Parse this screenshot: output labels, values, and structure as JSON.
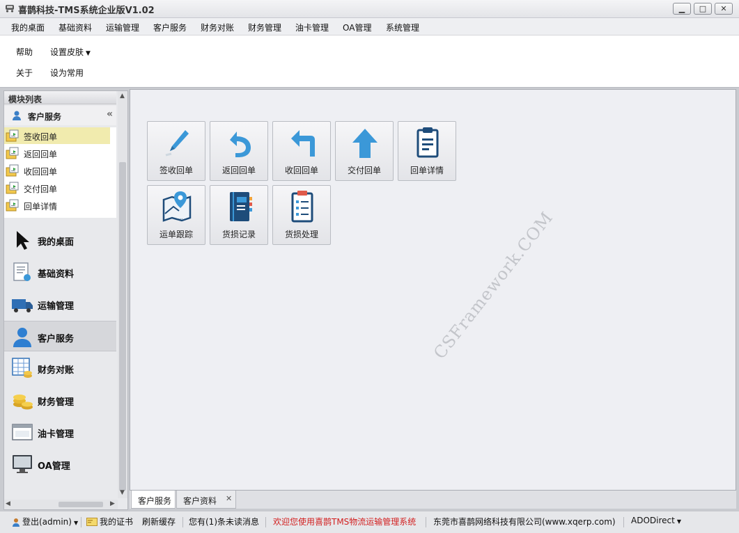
{
  "window": {
    "title": "喜鹊科技-TMS系统企业版V1.02",
    "buttons": [
      "▁",
      "□",
      "✕"
    ]
  },
  "menubar": {
    "items": [
      "我的桌面",
      "基础资料",
      "运输管理",
      "客户服务",
      "财务对账",
      "财务管理",
      "油卡管理",
      "OA管理",
      "系统管理"
    ]
  },
  "ribbon": {
    "help": "帮助",
    "skin": "设置皮肤",
    "about": "关于",
    "favorite": "设为常用"
  },
  "left_panel": {
    "header": "模块列表",
    "group": "客户服务",
    "collapse_glyph": "«",
    "sub_items": [
      {
        "label": "签收回单",
        "selected": true
      },
      {
        "label": "返回回单",
        "selected": false
      },
      {
        "label": "收回回单",
        "selected": false
      },
      {
        "label": "交付回单",
        "selected": false
      },
      {
        "label": "回单详情",
        "selected": false
      }
    ],
    "nav": [
      {
        "label": "我的桌面",
        "icon": "cursor-icon"
      },
      {
        "label": "基础资料",
        "icon": "document-icon"
      },
      {
        "label": "运输管理",
        "icon": "truck-icon"
      },
      {
        "label": "客户服务",
        "icon": "user-icon",
        "active": true
      },
      {
        "label": "财务对账",
        "icon": "spreadsheet-icon"
      },
      {
        "label": "财务管理",
        "icon": "coins-icon"
      },
      {
        "label": "油卡管理",
        "icon": "window-icon"
      },
      {
        "label": "OA管理",
        "icon": "monitor-icon"
      }
    ]
  },
  "tiles": [
    {
      "label": "签收回单",
      "icon": "pen-icon"
    },
    {
      "label": "返回回单",
      "icon": "undo-icon"
    },
    {
      "label": "收回回单",
      "icon": "return-arrow-icon"
    },
    {
      "label": "交付回单",
      "icon": "up-arrow-icon"
    },
    {
      "label": "回单详情",
      "icon": "clipboard-icon"
    },
    {
      "label": "运单跟踪",
      "icon": "map-pin-icon"
    },
    {
      "label": "货损记录",
      "icon": "notebook-icon"
    },
    {
      "label": "货损处理",
      "icon": "checklist-icon"
    }
  ],
  "watermark": "CSFramework.COM",
  "tabs": [
    {
      "label": "客户服务",
      "active": true
    },
    {
      "label": "客户资料",
      "active": false,
      "close": "✕"
    }
  ],
  "status": {
    "login": "登出(admin)",
    "cert": "我的证书",
    "refresh": "刷新缓存",
    "messages": "您有(1)条未读消息",
    "welcome": "欢迎您使用喜鹊TMS物流运输管理系统",
    "company": "东莞市喜鹊网络科技有限公司(www.xqerp.com)",
    "db": "ADODirect"
  },
  "colors": {
    "accent_blue": "#3b98d8",
    "welcome_text": "#d22020",
    "selected_row": "#f1ebae"
  }
}
